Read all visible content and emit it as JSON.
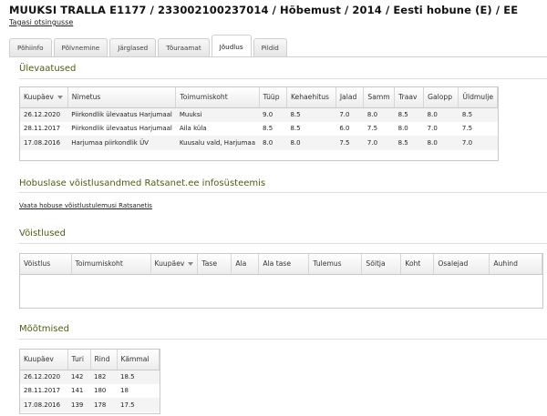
{
  "header": {
    "title": "MUUKSI TRALLA E1177 / 233002100237014 / Hõbemust / 2014 / Eesti hobune (E) / EE",
    "back_link": "Tagasi otsingusse"
  },
  "tabs": [
    {
      "label": "Põhiinfo",
      "active": false
    },
    {
      "label": "Põlvnemine",
      "active": false
    },
    {
      "label": "Järglased",
      "active": false
    },
    {
      "label": "Tõuraamat",
      "active": false
    },
    {
      "label": "Jõudlus",
      "active": true
    },
    {
      "label": "Pildid",
      "active": false
    }
  ],
  "overviews": {
    "title": "Ülevaatused",
    "columns": [
      "Kuupäev",
      "Nimetus",
      "Toimumiskoht",
      "Tüüp",
      "Kehaehitus",
      "Jalad",
      "Samm",
      "Traav",
      "Galopp",
      "Üldmulje"
    ],
    "rows": [
      [
        "26.12.2020",
        "Piirkondlik ülevaatus Harjumaal",
        "Muuksi",
        "9.0",
        "8.5",
        "7.0",
        "8.0",
        "8.5",
        "8.0",
        "8.5"
      ],
      [
        "28.11.2017",
        "Piirkondlik ülevaatus Harjumaal",
        "Aila küla",
        "8.5",
        "8.5",
        "6.0",
        "7.5",
        "8.0",
        "7.0",
        "7.5"
      ],
      [
        "17.08.2016",
        "Harjumaa piirkondlik ÜV",
        "Kuusalu vald, Harjumaa",
        "8.0",
        "8.0",
        "7.5",
        "7.0",
        "8.5",
        "8.0",
        "7.0"
      ]
    ]
  },
  "ratsanet": {
    "title": "Hobuslase võistlusandmed Ratsanet.ee infosüsteemis",
    "link": "Vaata hobuse võistlustulemusi Ratsanetis"
  },
  "competitions": {
    "title": "Võistlused",
    "columns": [
      "Võistlus",
      "Toimumiskoht",
      "Kuupäev",
      "Tase",
      "Ala",
      "Ala tase",
      "Tulemus",
      "Sõitja",
      "Koht",
      "Osalejad",
      "Auhind"
    ],
    "rows": []
  },
  "measurements": {
    "title": "Mõõtmised",
    "columns": [
      "Kuupäev",
      "Turi",
      "Rind",
      "Kämmal"
    ],
    "rows": [
      [
        "26.12.2020",
        "142",
        "182",
        "18.5"
      ],
      [
        "28.11.2017",
        "141",
        "180",
        "18"
      ],
      [
        "17.08.2016",
        "139",
        "178",
        "17.5"
      ]
    ]
  },
  "colors": {
    "section_title": "#4c5e12",
    "row_stripe": "#f4f4f4",
    "border": "#c9c9c9"
  }
}
